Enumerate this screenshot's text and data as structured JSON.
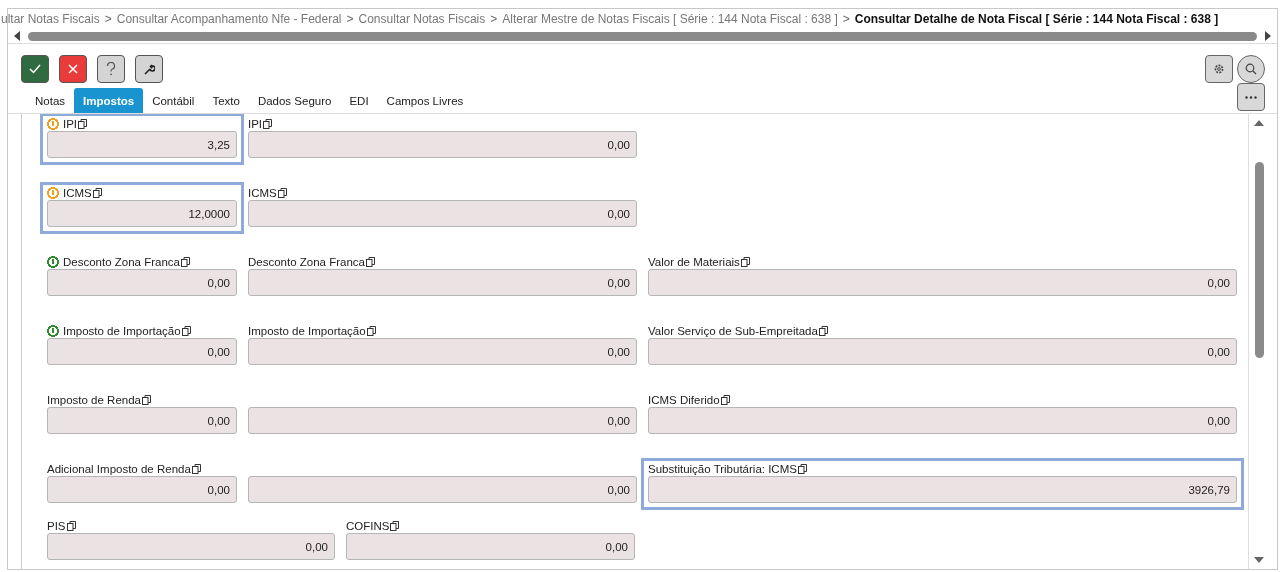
{
  "breadcrumb": [
    {
      "label": "ultar Notas Fiscais",
      "current": false
    },
    {
      "prefix": ">",
      "label": "Consultar Acompanhamento Nfe - Federal",
      "current": false
    },
    {
      "prefix": ">",
      "label": "Consultar Notas Fiscais",
      "current": false
    },
    {
      "prefix": ">",
      "label": "Alterar Mestre de Notas Fiscais [ Série : 144 Nota Fiscal : 638 ]",
      "current": false
    },
    {
      "prefix": ">",
      "label": "Consultar Detalhe de Nota Fiscal [ Série : 144 Nota Fiscal : 638 ]",
      "current": true
    }
  ],
  "toolbar": [
    {
      "kind": "confirm"
    },
    {
      "kind": "cancel"
    },
    {
      "kind": "help"
    },
    {
      "kind": "tools"
    }
  ],
  "toolbar_right": [
    {
      "kind": "settings"
    },
    {
      "kind": "search"
    }
  ],
  "tabs": [
    {
      "label": "Notas",
      "selected": false
    },
    {
      "label": "Impostos",
      "selected": true
    },
    {
      "label": "Contábil",
      "selected": false
    },
    {
      "label": "Texto",
      "selected": false
    },
    {
      "label": "Dados Seguro",
      "selected": false
    },
    {
      "label": "EDI",
      "selected": false
    },
    {
      "label": "Campos Livres",
      "selected": false
    }
  ],
  "rows": [
    {
      "kind": "wide",
      "fields": [
        {
          "label": "IPI",
          "color": "#f0a020",
          "highlighted": true,
          "value": "3,25"
        },
        {
          "label": "IPI",
          "highlighted": false,
          "value": "0,00"
        }
      ]
    },
    {
      "kind": "wide",
      "fields": [
        {
          "label": "ICMS",
          "color": "#f0a020",
          "highlighted": true,
          "value": "12,0000"
        },
        {
          "label": "ICMS",
          "highlighted": false,
          "value": "0,00"
        }
      ]
    },
    {
      "kind": "wide",
      "fields": [
        {
          "label": "Desconto Zona Franca",
          "color": "#2e8b2e",
          "highlighted": false,
          "value": "0,00"
        },
        {
          "label": "Desconto Zona Franca",
          "highlighted": false,
          "value": "0,00"
        },
        {
          "label": "Valor de Materiais",
          "highlighted": false,
          "value": "0,00"
        }
      ]
    },
    {
      "kind": "wide",
      "fields": [
        {
          "label": "Imposto de Importação",
          "color": "#2e8b2e",
          "highlighted": false,
          "value": "0,00"
        },
        {
          "label": "Imposto de Importação",
          "highlighted": false,
          "value": "0,00"
        },
        {
          "label": "Valor Serviço de Sub-Empreitada",
          "highlighted": false,
          "value": "0,00"
        }
      ]
    },
    {
      "kind": "wide",
      "fields": [
        {
          "label": "Imposto de Renda",
          "highlighted": false,
          "value": "0,00"
        },
        {
          "highlighted": false,
          "value": "0,00"
        },
        {
          "label": "ICMS Diferido",
          "highlighted": false,
          "value": "0,00"
        }
      ]
    },
    {
      "kind": "wide",
      "fields": [
        {
          "label": "Adicional Imposto de Renda",
          "highlighted": false,
          "value": "0,00"
        },
        {
          "highlighted": false,
          "value": "0,00"
        },
        {
          "label": "Substituição Tributária: ICMS",
          "highlighted": true,
          "value": "3926,79"
        }
      ]
    },
    {
      "kind": "split",
      "fields": [
        {
          "label": "PIS",
          "highlighted": false,
          "value": "0,00"
        },
        {
          "label": "COFINS",
          "highlighted": false,
          "value": "0,00"
        }
      ]
    }
  ]
}
